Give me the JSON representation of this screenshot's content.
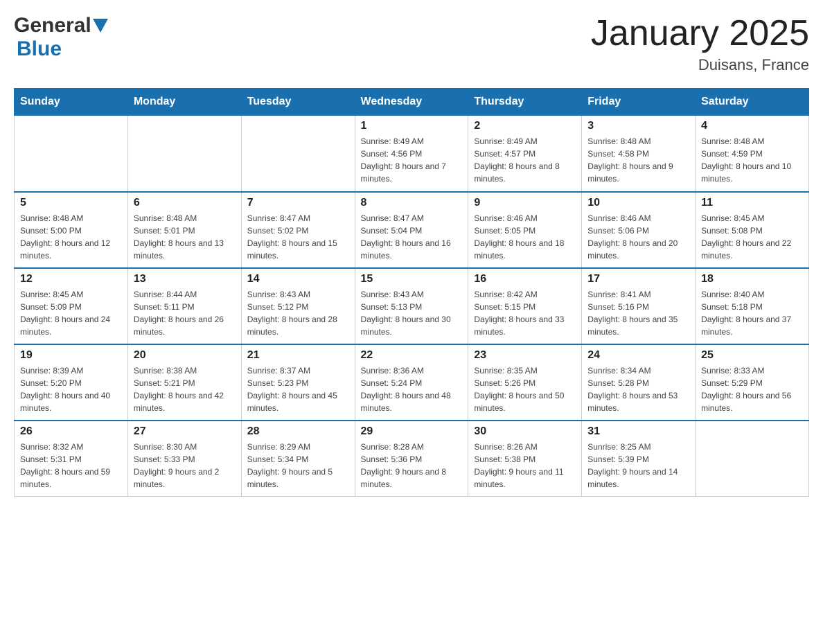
{
  "header": {
    "title": "January 2025",
    "subtitle": "Duisans, France",
    "logo_general": "General",
    "logo_blue": "Blue"
  },
  "days_of_week": [
    "Sunday",
    "Monday",
    "Tuesday",
    "Wednesday",
    "Thursday",
    "Friday",
    "Saturday"
  ],
  "weeks": [
    [
      {
        "day": "",
        "info": ""
      },
      {
        "day": "",
        "info": ""
      },
      {
        "day": "",
        "info": ""
      },
      {
        "day": "1",
        "info": "Sunrise: 8:49 AM\nSunset: 4:56 PM\nDaylight: 8 hours and 7 minutes."
      },
      {
        "day": "2",
        "info": "Sunrise: 8:49 AM\nSunset: 4:57 PM\nDaylight: 8 hours and 8 minutes."
      },
      {
        "day": "3",
        "info": "Sunrise: 8:48 AM\nSunset: 4:58 PM\nDaylight: 8 hours and 9 minutes."
      },
      {
        "day": "4",
        "info": "Sunrise: 8:48 AM\nSunset: 4:59 PM\nDaylight: 8 hours and 10 minutes."
      }
    ],
    [
      {
        "day": "5",
        "info": "Sunrise: 8:48 AM\nSunset: 5:00 PM\nDaylight: 8 hours and 12 minutes."
      },
      {
        "day": "6",
        "info": "Sunrise: 8:48 AM\nSunset: 5:01 PM\nDaylight: 8 hours and 13 minutes."
      },
      {
        "day": "7",
        "info": "Sunrise: 8:47 AM\nSunset: 5:02 PM\nDaylight: 8 hours and 15 minutes."
      },
      {
        "day": "8",
        "info": "Sunrise: 8:47 AM\nSunset: 5:04 PM\nDaylight: 8 hours and 16 minutes."
      },
      {
        "day": "9",
        "info": "Sunrise: 8:46 AM\nSunset: 5:05 PM\nDaylight: 8 hours and 18 minutes."
      },
      {
        "day": "10",
        "info": "Sunrise: 8:46 AM\nSunset: 5:06 PM\nDaylight: 8 hours and 20 minutes."
      },
      {
        "day": "11",
        "info": "Sunrise: 8:45 AM\nSunset: 5:08 PM\nDaylight: 8 hours and 22 minutes."
      }
    ],
    [
      {
        "day": "12",
        "info": "Sunrise: 8:45 AM\nSunset: 5:09 PM\nDaylight: 8 hours and 24 minutes."
      },
      {
        "day": "13",
        "info": "Sunrise: 8:44 AM\nSunset: 5:11 PM\nDaylight: 8 hours and 26 minutes."
      },
      {
        "day": "14",
        "info": "Sunrise: 8:43 AM\nSunset: 5:12 PM\nDaylight: 8 hours and 28 minutes."
      },
      {
        "day": "15",
        "info": "Sunrise: 8:43 AM\nSunset: 5:13 PM\nDaylight: 8 hours and 30 minutes."
      },
      {
        "day": "16",
        "info": "Sunrise: 8:42 AM\nSunset: 5:15 PM\nDaylight: 8 hours and 33 minutes."
      },
      {
        "day": "17",
        "info": "Sunrise: 8:41 AM\nSunset: 5:16 PM\nDaylight: 8 hours and 35 minutes."
      },
      {
        "day": "18",
        "info": "Sunrise: 8:40 AM\nSunset: 5:18 PM\nDaylight: 8 hours and 37 minutes."
      }
    ],
    [
      {
        "day": "19",
        "info": "Sunrise: 8:39 AM\nSunset: 5:20 PM\nDaylight: 8 hours and 40 minutes."
      },
      {
        "day": "20",
        "info": "Sunrise: 8:38 AM\nSunset: 5:21 PM\nDaylight: 8 hours and 42 minutes."
      },
      {
        "day": "21",
        "info": "Sunrise: 8:37 AM\nSunset: 5:23 PM\nDaylight: 8 hours and 45 minutes."
      },
      {
        "day": "22",
        "info": "Sunrise: 8:36 AM\nSunset: 5:24 PM\nDaylight: 8 hours and 48 minutes."
      },
      {
        "day": "23",
        "info": "Sunrise: 8:35 AM\nSunset: 5:26 PM\nDaylight: 8 hours and 50 minutes."
      },
      {
        "day": "24",
        "info": "Sunrise: 8:34 AM\nSunset: 5:28 PM\nDaylight: 8 hours and 53 minutes."
      },
      {
        "day": "25",
        "info": "Sunrise: 8:33 AM\nSunset: 5:29 PM\nDaylight: 8 hours and 56 minutes."
      }
    ],
    [
      {
        "day": "26",
        "info": "Sunrise: 8:32 AM\nSunset: 5:31 PM\nDaylight: 8 hours and 59 minutes."
      },
      {
        "day": "27",
        "info": "Sunrise: 8:30 AM\nSunset: 5:33 PM\nDaylight: 9 hours and 2 minutes."
      },
      {
        "day": "28",
        "info": "Sunrise: 8:29 AM\nSunset: 5:34 PM\nDaylight: 9 hours and 5 minutes."
      },
      {
        "day": "29",
        "info": "Sunrise: 8:28 AM\nSunset: 5:36 PM\nDaylight: 9 hours and 8 minutes."
      },
      {
        "day": "30",
        "info": "Sunrise: 8:26 AM\nSunset: 5:38 PM\nDaylight: 9 hours and 11 minutes."
      },
      {
        "day": "31",
        "info": "Sunrise: 8:25 AM\nSunset: 5:39 PM\nDaylight: 9 hours and 14 minutes."
      },
      {
        "day": "",
        "info": ""
      }
    ]
  ]
}
